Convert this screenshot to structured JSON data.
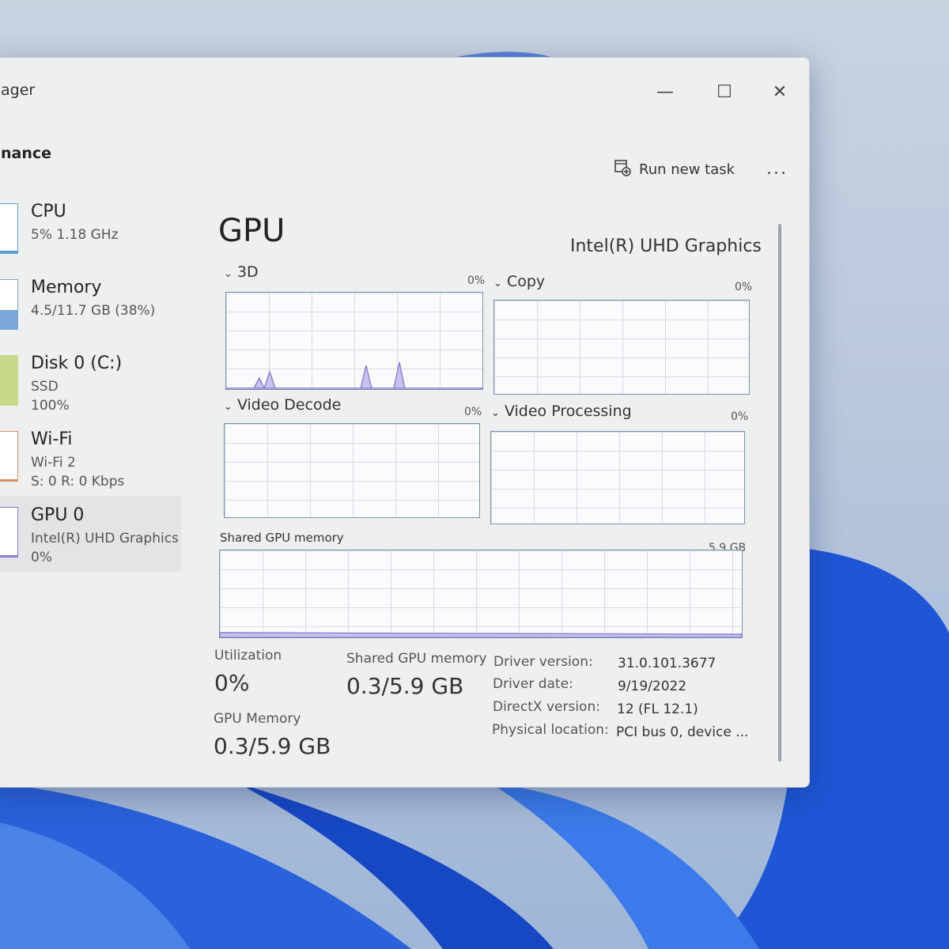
{
  "window": {
    "title": "ager",
    "section": "nance",
    "run_new_task": "Run new task",
    "more": "..."
  },
  "sidebar": {
    "items": [
      {
        "name": "CPU",
        "sub1": "5%  1.18 GHz",
        "sub2": "",
        "sub3": "",
        "fill": 0.05,
        "color": "#5b9bd5"
      },
      {
        "name": "Memory",
        "sub1": "4.5/11.7 GB (38%)",
        "sub2": "",
        "sub3": "",
        "fill": 0.38,
        "color": "#7aa7d8"
      },
      {
        "name": "Disk 0 (C:)",
        "sub1": "SSD",
        "sub2": "100%",
        "sub3": "",
        "fill": 1.0,
        "color": "#c8d98a"
      },
      {
        "name": "Wi-Fi",
        "sub1": "Wi-Fi 2",
        "sub2": "S: 0 R: 0 Kbps",
        "sub3": "",
        "fill": 0.0,
        "color": "#d88f6a"
      },
      {
        "name": "GPU 0",
        "sub1": "Intel(R) UHD Graphics",
        "sub2": "0%",
        "sub3": "",
        "fill": 0.0,
        "color": "#8f7ad8"
      }
    ]
  },
  "main": {
    "title": "GPU",
    "adapter": "Intel(R) UHD Graphics",
    "graphs": {
      "g3d": {
        "label": "3D",
        "pct": "0%"
      },
      "copy": {
        "label": "Copy",
        "pct": "0%"
      },
      "decode": {
        "label": "Video Decode",
        "pct": "0%"
      },
      "processing": {
        "label": "Video Processing",
        "pct": "0%"
      },
      "shared": {
        "label": "Shared GPU memory",
        "pct": "5.9 GB"
      }
    },
    "stats": {
      "utilization_label": "Utilization",
      "utilization_value": "0%",
      "shared_label": "Shared GPU memory",
      "shared_value": "0.3/5.9 GB",
      "gpu_mem_label": "GPU Memory",
      "gpu_mem_value": "0.3/5.9 GB"
    },
    "info": [
      {
        "label": "Driver version:",
        "value": "31.0.101.3677"
      },
      {
        "label": "Driver date:",
        "value": "9/19/2022"
      },
      {
        "label": "DirectX version:",
        "value": "12 (FL 12.1)"
      },
      {
        "label": "Physical location:",
        "value": "PCI bus 0, device ..."
      }
    ]
  },
  "colors": {
    "graph_line": "#8a7fd0",
    "graph_fill": "#c7c2ee"
  }
}
